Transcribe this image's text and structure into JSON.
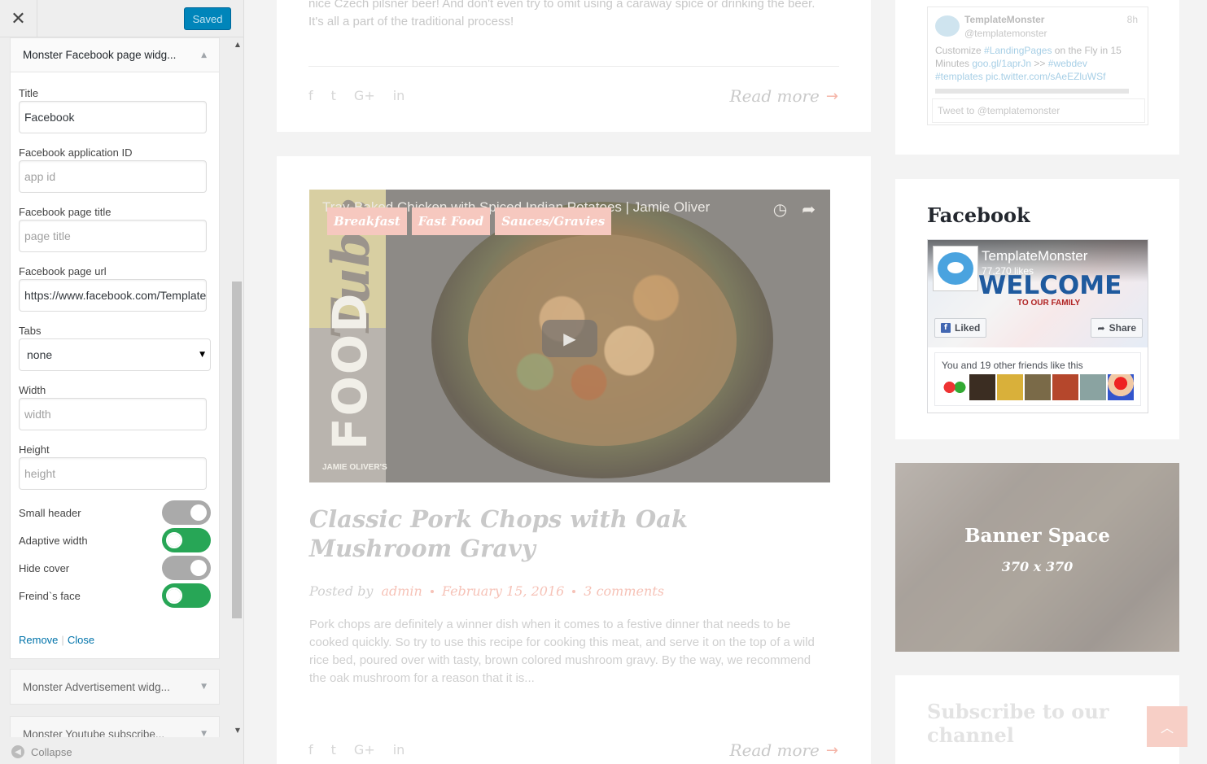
{
  "sidebar": {
    "close_icon": "close-icon",
    "saved_label": "Saved",
    "widgets": {
      "facebook": {
        "title": "Monster Facebook page widg...",
        "fields": {
          "title": {
            "label": "Title",
            "value": "Facebook"
          },
          "app_id": {
            "label": "Facebook application ID",
            "placeholder": "app id"
          },
          "page_title": {
            "label": "Facebook page title",
            "placeholder": "page title"
          },
          "page_url": {
            "label": "Facebook page url",
            "value": "https://www.facebook.com/TemplateMonster"
          },
          "tabs": {
            "label": "Tabs",
            "value": "none"
          },
          "width": {
            "label": "Width",
            "placeholder": "width"
          },
          "height": {
            "label": "Height",
            "placeholder": "height"
          }
        },
        "toggles": [
          {
            "label": "Small header",
            "on": false
          },
          {
            "label": "Adaptive width",
            "on": true
          },
          {
            "label": "Hide cover",
            "on": false
          },
          {
            "label": "Freind`s face",
            "on": true
          }
        ],
        "remove_label": "Remove",
        "separator": "|",
        "close_label": "Close"
      },
      "advertisement": {
        "title": "Monster Advertisement widg..."
      },
      "youtube": {
        "title": "Monster Youtube subscribe..."
      }
    },
    "collapse_label": "Collapse"
  },
  "preview": {
    "post1": {
      "excerpt": "nice Czech pilsner beer! And don't even try to omit using a caraway spice or drinking the beer. It's all a part of the traditional process!",
      "share_icons": [
        "f",
        "t",
        "G+",
        "in"
      ],
      "read_more": "Read more"
    },
    "post2": {
      "video_title": "Tray-Baked Chicken with Spiced Indian Potatoes | Jamie Oliver",
      "video_brand": "FOOD",
      "video_brand2": "Tube",
      "video_author": "JAMIE OLIVER'S",
      "categories": [
        "Breakfast",
        "Fast Food",
        "Sauces/Gravies"
      ],
      "title": "Classic Pork Chops with Oak Mushroom Gravy",
      "posted_by": "Posted by",
      "author": "admin",
      "date": "February 15, 2016",
      "comments": "3 comments",
      "excerpt": "Pork chops are definitely a winner dish when it comes to a festive dinner that needs to be cooked quickly. So try to use this recipe for cooking this meat, and serve it on the top of a wild rice bed, poured over with tasty, brown colored mushroom gravy. By the way, we recommend the oak mushroom for a reason that it is...",
      "read_more": "Read more"
    },
    "twitter": {
      "name": "TemplateMonster",
      "handle": "@templatemonster",
      "time": "8h",
      "text_plain1": "Customize ",
      "link1": "#LandingPages",
      "text_plain2": " on the Fly in 15 Minutes ",
      "link2": "goo.gl/1aprJn",
      "text_plain3": " >> ",
      "link3": "#webdev",
      "link4": "#templates",
      "link5": "pic.twitter.com/sAeEZluWSf",
      "tweet_placeholder": "Tweet to @templatemonster"
    },
    "facebook": {
      "widget_title": "Facebook",
      "page_name": "TemplateMonster",
      "likes": "77,270 likes",
      "cover_headline": "WELCOME",
      "cover_tagline": "TO OUR FAMILY",
      "liked_label": "Liked",
      "share_label": "Share",
      "friends_text": "You and 19 other friends like this"
    },
    "banner": {
      "title": "Banner Space",
      "size": "370 x 370"
    },
    "subscribe": {
      "title": "Subscribe to our channel"
    }
  },
  "colors": {
    "accent": "#0085ba",
    "toggle_on": "#27a656",
    "toggle_off": "#aaaaaa",
    "link": "#0073aa"
  }
}
